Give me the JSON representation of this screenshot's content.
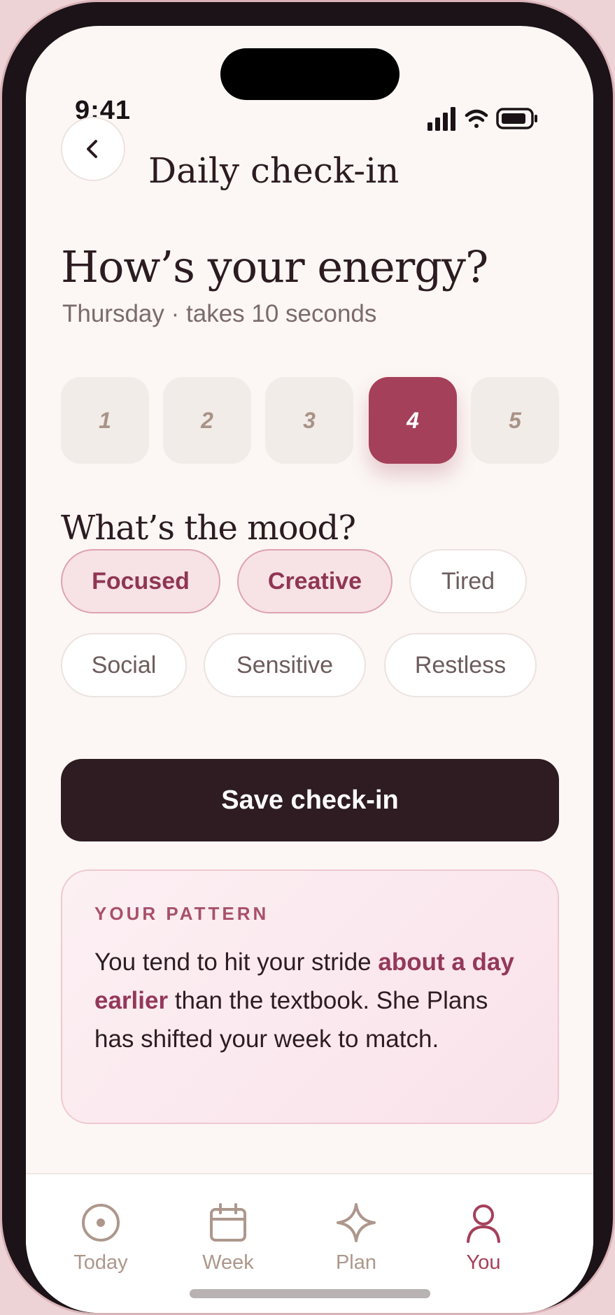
{
  "status_bar": {
    "time": "9:41"
  },
  "header": {
    "title": "Daily check-in"
  },
  "energy": {
    "question": "How’s your energy?",
    "subtitle": "Thursday · takes 10 seconds",
    "options": [
      "1",
      "2",
      "3",
      "4",
      "5"
    ],
    "selected": "4"
  },
  "mood": {
    "question": "What’s the mood?",
    "chips": [
      {
        "label": "Focused",
        "selected": true
      },
      {
        "label": "Creative",
        "selected": true
      },
      {
        "label": "Tired",
        "selected": false
      },
      {
        "label": "Social",
        "selected": false
      },
      {
        "label": "Sensitive",
        "selected": false
      },
      {
        "label": "Restless",
        "selected": false
      }
    ]
  },
  "save_button": {
    "label": "Save check-in"
  },
  "pattern": {
    "label": "YOUR PATTERN",
    "text_before": "You tend to hit your stride ",
    "text_bold": "about a day earlier",
    "text_after": " than the textbook. She Plans has shifted your week to match."
  },
  "tabs": [
    {
      "label": "Today",
      "icon": "target-icon",
      "active": false
    },
    {
      "label": "Week",
      "icon": "calendar-icon",
      "active": false
    },
    {
      "label": "Plan",
      "icon": "sparkle-icon",
      "active": false
    },
    {
      "label": "You",
      "icon": "person-icon",
      "active": true
    }
  ],
  "colors": {
    "accent": "#a5405a",
    "background": "#fcf7f4",
    "button_dark": "#2e1c22",
    "chip_selected": "#f7e2e6"
  }
}
